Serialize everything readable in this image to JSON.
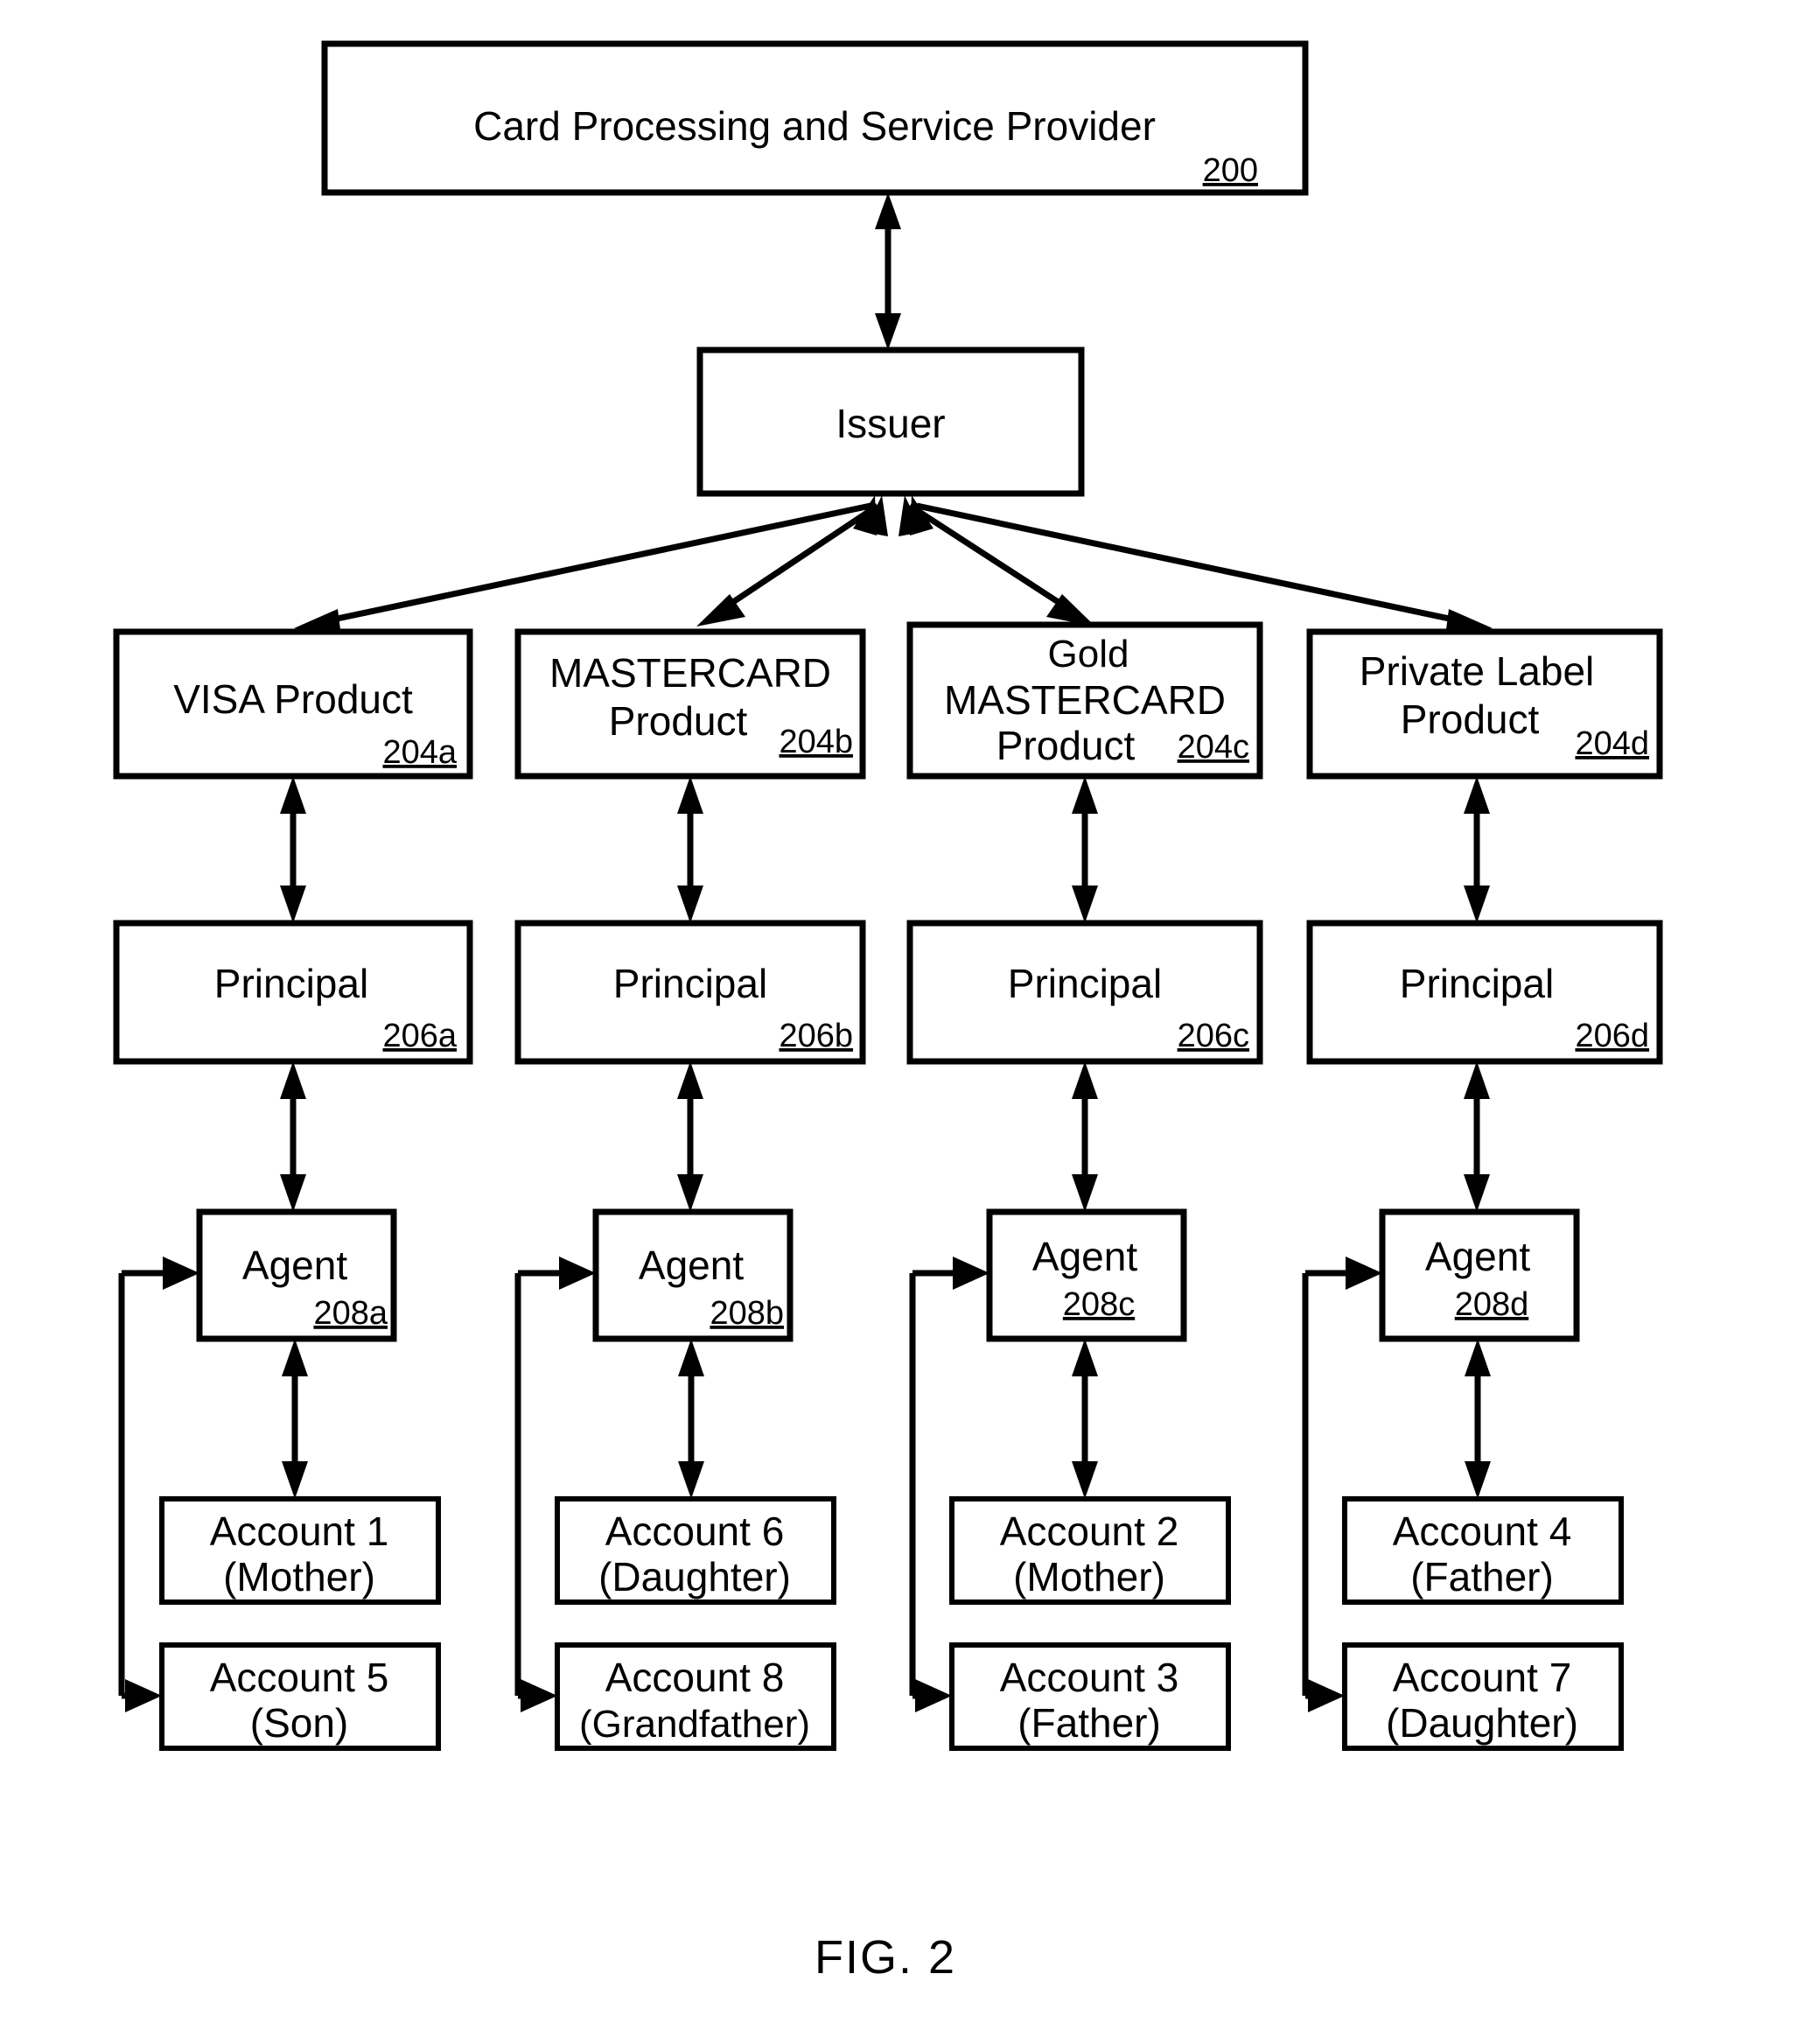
{
  "figure": {
    "caption": "FIG. 2"
  },
  "nodes": {
    "provider": {
      "label": "Card Processing and Service Provider",
      "ref": "200"
    },
    "issuer": {
      "label": "Issuer"
    },
    "products": [
      {
        "line1": "VISA Product",
        "line2": "",
        "line3": "",
        "ref": "204a"
      },
      {
        "line1": "MASTERCARD",
        "line2": "Product",
        "line3": "",
        "ref": "204b"
      },
      {
        "line1": "Gold",
        "line2": "MASTERCARD",
        "line3": "Product",
        "ref": "204c"
      },
      {
        "line1": "Private Label",
        "line2": "Product",
        "line3": "",
        "ref": "204d"
      }
    ],
    "principals": [
      {
        "label": "Principal",
        "ref": "206a"
      },
      {
        "label": "Principal",
        "ref": "206b"
      },
      {
        "label": "Principal",
        "ref": "206c"
      },
      {
        "label": "Principal",
        "ref": "206d"
      }
    ],
    "agents": [
      {
        "label": "Agent",
        "ref": "208a"
      },
      {
        "label": "Agent",
        "ref": "208b"
      },
      {
        "label": "Agent",
        "ref": "208c"
      },
      {
        "label": "Agent",
        "ref": "208d"
      }
    ],
    "accounts": [
      {
        "line1": "Account 1",
        "line2": "(Mother)"
      },
      {
        "line1": "Account 6",
        "line2": "(Daughter)"
      },
      {
        "line1": "Account 2",
        "line2": "(Mother)"
      },
      {
        "line1": "Account 4",
        "line2": "(Father)"
      },
      {
        "line1": "Account 5",
        "line2": "(Son)"
      },
      {
        "line1": "Account 8",
        "line2": "(Grandfather)"
      },
      {
        "line1": "Account 3",
        "line2": "(Father)"
      },
      {
        "line1": "Account 7",
        "line2": "(Daughter)"
      }
    ]
  },
  "colors": {
    "ink": "#000000",
    "paper": "#ffffff"
  }
}
